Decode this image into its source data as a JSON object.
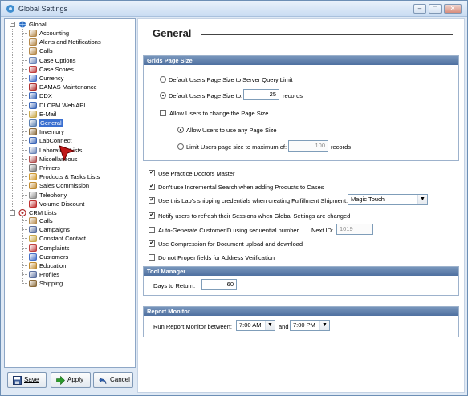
{
  "window": {
    "title": "Global Settings",
    "controls": [
      "–",
      "□",
      "✕"
    ]
  },
  "tree": {
    "root_global": "Global",
    "global_items": [
      {
        "label": "Accounting",
        "icon": "pencil-icon",
        "color": "#b5894a"
      },
      {
        "label": "Alerts and Notifications",
        "icon": "pencil-icon",
        "color": "#b5894a"
      },
      {
        "label": "Calls",
        "icon": "pencil-icon",
        "color": "#b5894a"
      },
      {
        "label": "Case Options",
        "icon": "wrench-icon",
        "color": "#6b86b8"
      },
      {
        "label": "Case Scores",
        "icon": "pencil-icon",
        "color": "#c04040"
      },
      {
        "label": "Currency",
        "icon": "currency-icon",
        "color": "#4670c8"
      },
      {
        "label": "DAMAS Maintenance",
        "icon": "maintenance-icon",
        "color": "#b03030"
      },
      {
        "label": "DDX",
        "icon": "pen-icon",
        "color": "#3b66b8"
      },
      {
        "label": "DLCPM Web API",
        "icon": "pen-icon",
        "color": "#3b66b8"
      },
      {
        "label": "E-Mail",
        "icon": "email-icon",
        "color": "#c9a84a"
      },
      {
        "label": "General",
        "icon": "window-icon",
        "color": "#5a7fb0"
      },
      {
        "label": "Inventory",
        "icon": "inventory-icon",
        "color": "#8a6a3a"
      },
      {
        "label": "LabConnect",
        "icon": "pen-icon",
        "color": "#3b66b8"
      },
      {
        "label": "Laboratory Lists",
        "icon": "list-icon",
        "color": "#6b86b8"
      },
      {
        "label": "Miscellaneous",
        "icon": "misc-icon",
        "color": "#b05050"
      },
      {
        "label": "Printers",
        "icon": "printer-icon",
        "color": "#7a7a7a"
      },
      {
        "label": "Products & Tasks Lists",
        "icon": "products-icon",
        "color": "#d09a30"
      },
      {
        "label": "Sales Commission",
        "icon": "commission-icon",
        "color": "#c08a30"
      },
      {
        "label": "Telephony",
        "icon": "phone-icon",
        "color": "#8a8a8a"
      },
      {
        "label": "Volume Discount",
        "icon": "percent-icon",
        "color": "#c03030"
      }
    ],
    "root_crm": "CRM Lists",
    "crm_items": [
      {
        "label": "Calls",
        "icon": "pencil-icon",
        "color": "#b5894a"
      },
      {
        "label": "Campaigns",
        "icon": "campaign-icon",
        "color": "#5a6fa0"
      },
      {
        "label": "Constant Contact",
        "icon": "email-icon",
        "color": "#c9a84a"
      },
      {
        "label": "Complaints",
        "icon": "pencil-icon",
        "color": "#c04040"
      },
      {
        "label": "Customers",
        "icon": "customers-icon",
        "color": "#4670c8"
      },
      {
        "label": "Education",
        "icon": "education-icon",
        "color": "#c08a30"
      },
      {
        "label": "Profiles",
        "icon": "profiles-icon",
        "color": "#5a6fa0"
      },
      {
        "label": "Shipping",
        "icon": "shipping-icon",
        "color": "#8a6a3a"
      }
    ]
  },
  "buttons": {
    "save": "Save",
    "apply": "Apply",
    "cancel": "Cancel"
  },
  "main": {
    "title": "General",
    "grids": {
      "header": "Grids Page Size",
      "opt_default_server": "Default Users Page Size to Server Query Limit",
      "opt_default_to": "Default Users Page Size to:",
      "default_to_value": "25",
      "records_1": "records",
      "allow_change": "Allow Users to change the Page Size",
      "allow_any": "Allow Users to use any Page Size",
      "limit_to": "Limit Users page size to maximum of:",
      "limit_value": "100",
      "records_2": "records"
    },
    "options": {
      "practice_doctors": "Use Practice Doctors Master",
      "no_incremental": "Don't use Incremental Search when adding Products to Cases",
      "shipping_creds": "Use this Lab's shipping credentials when creating Fulfillment Shipment:",
      "shipping_select": "Magic Touch",
      "notify_refresh": "Notify users to refresh their Sessions when Global Settings are changed",
      "auto_customer": "Auto-Generate CustomerID using sequential number",
      "next_id_label": "Next ID:",
      "next_id_value": "1019",
      "compression": "Use Compression for Document upload and download",
      "no_proper": "Do not Proper fields for Address Verification"
    },
    "tool_manager": {
      "header": "Tool Manager",
      "days_label": "Days to Return:",
      "days_value": "60"
    },
    "report_monitor": {
      "header": "Report Monitor",
      "run_label": "Run Report Monitor between:",
      "start": "7:00 AM",
      "and": "and",
      "end": "7:00 PM"
    }
  }
}
